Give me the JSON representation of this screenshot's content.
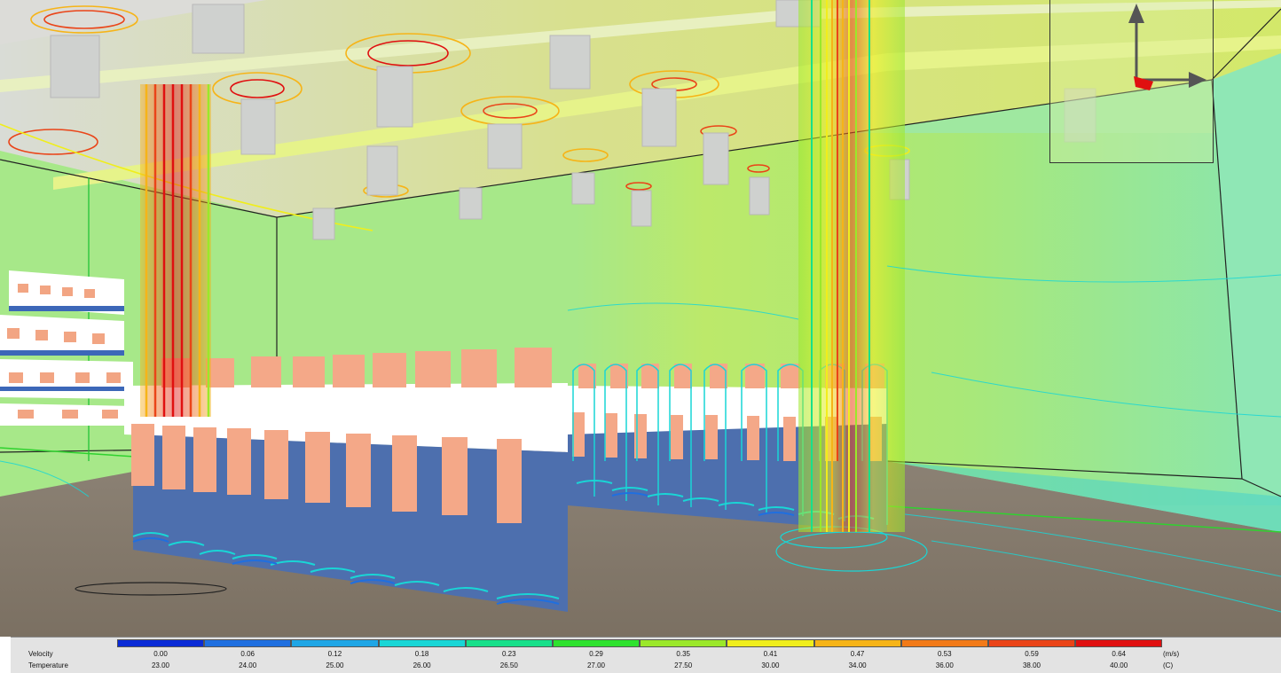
{
  "legend": {
    "velocity_label": "Velocity",
    "temperature_label": "Temperature",
    "velocity_unit": "(m/s)",
    "temperature_unit": "(C)",
    "colors": [
      "#0a2bd6",
      "#1f6fe0",
      "#1fa6e6",
      "#19d6d6",
      "#18e08a",
      "#2ee22e",
      "#9be82a",
      "#f0ee1c",
      "#f6b418",
      "#f27a18",
      "#ea4418",
      "#e01010"
    ],
    "velocity_ticks": [
      "0.00",
      "0.06",
      "0.12",
      "0.18",
      "0.23",
      "0.29",
      "0.35",
      "0.41",
      "0.47",
      "0.53",
      "0.59",
      "0.64"
    ],
    "temperature_ticks": [
      "23.00",
      "24.00",
      "25.00",
      "26.00",
      "26.50",
      "27.00",
      "27.50",
      "30.00",
      "34.00",
      "36.00",
      "38.00",
      "40.00"
    ]
  },
  "scene": {
    "description_icon": "cfd-airflow-visualization",
    "triad_icon": "axis-triad-icon"
  }
}
